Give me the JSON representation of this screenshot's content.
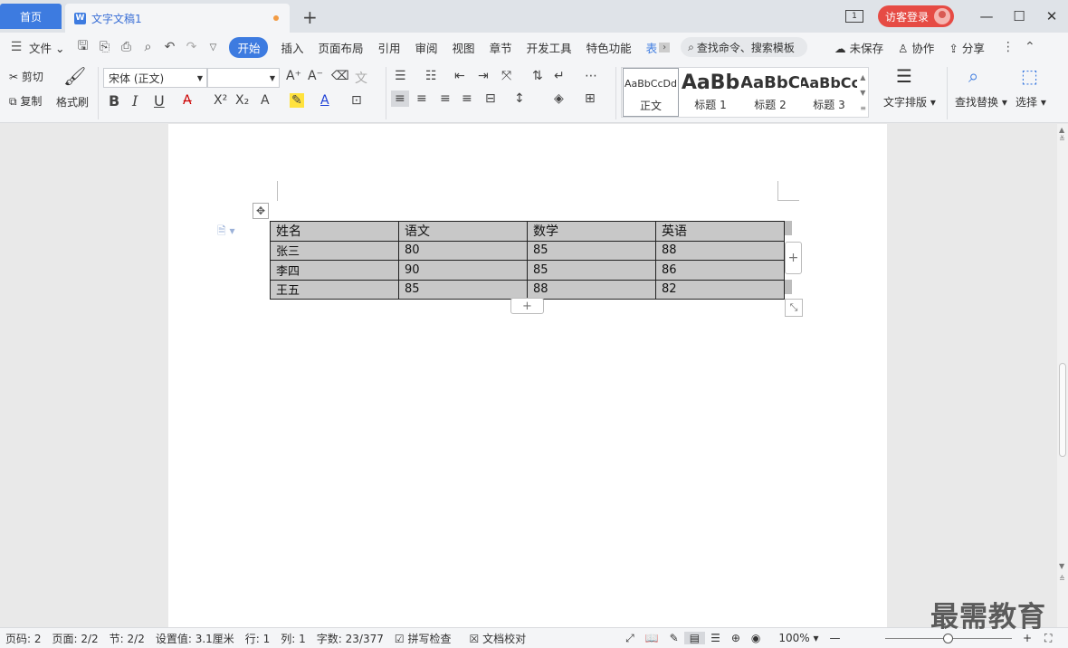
{
  "titlebar": {
    "home_tab": "首页",
    "doc_tab": "文字文稿1",
    "doc_icon": "W",
    "new_tab": "+",
    "page_count": "1",
    "login": "访客登录",
    "minimize": "—",
    "maximize": "☐",
    "close": "✕"
  },
  "menubar": {
    "file": "文件",
    "tabs": [
      "开始",
      "插入",
      "页面布局",
      "引用",
      "审阅",
      "视图",
      "章节",
      "开发工具",
      "特色功能",
      "表"
    ],
    "search": "查找命令、搜索模板",
    "unsaved": "未保存",
    "collab": "协作",
    "share": "分享"
  },
  "ribbon": {
    "cut": "剪切",
    "copy": "复制",
    "format_painter": "格式刷",
    "font_name": "宋体 (正文)",
    "font_size": "",
    "bold": "B",
    "italic": "I",
    "underline": "U",
    "styles": [
      {
        "preview": "AaBbCcDd",
        "label": "正文"
      },
      {
        "preview": "AaBb",
        "label": "标题 1"
      },
      {
        "preview": "AaBbC",
        "label": "标题 2"
      },
      {
        "preview": "AaBbCc",
        "label": "标题 3"
      }
    ],
    "text_layout": "文字排版",
    "find_replace": "查找替换",
    "select": "选择"
  },
  "table": {
    "rows": [
      [
        "姓名",
        "语文",
        "数学",
        "英语"
      ],
      [
        "张三",
        "80",
        "85",
        "88"
      ],
      [
        "李四",
        "90",
        "85",
        "86"
      ],
      [
        "王五",
        "85",
        "88",
        "82"
      ]
    ]
  },
  "statusbar": {
    "page_no": "页码: 2",
    "pages": "页面: 2/2",
    "section": "节: 2/2",
    "setting": "设置值: 3.1厘米",
    "row": "行: 1",
    "col": "列: 1",
    "words": "字数: 23/377",
    "spell": "拼写检查",
    "proof": "文档校对",
    "zoom": "100%",
    "zoom_out": "—",
    "zoom_in": "+"
  },
  "watermark": "最需教育",
  "colors": {
    "accent": "#3d7be0",
    "login": "#e64b44",
    "table_fill": "#c8c8c8"
  }
}
